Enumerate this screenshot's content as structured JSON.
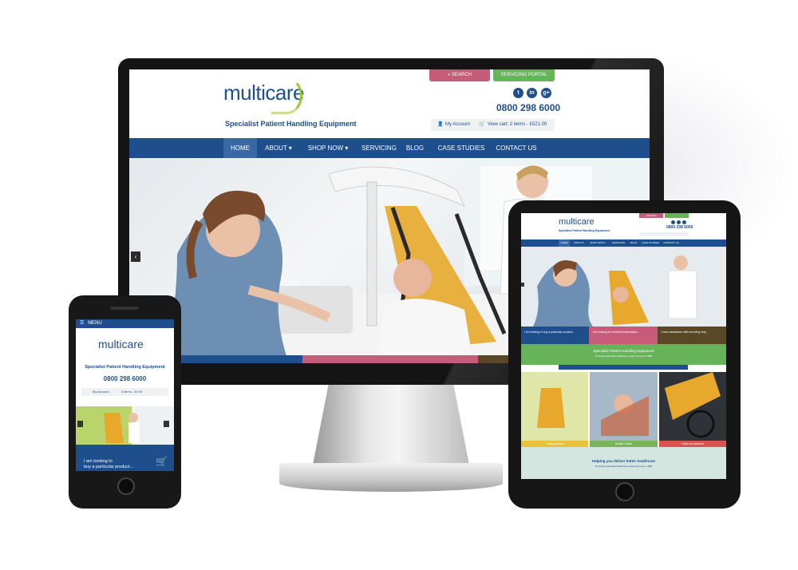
{
  "desktop": {
    "logo": "multicare",
    "tagline": "Specialist Patient Handling Equipment",
    "search_label": "SEARCH",
    "portal_label": "SERVICING PORTAL",
    "social": [
      "t",
      "in",
      "g+"
    ],
    "phone": "0800 298 6000",
    "my_account": "My Account",
    "cart": "View cart: 2 items - £521.00",
    "nav": [
      "HOME",
      "ABOUT ▾",
      "SHOP NOW ▾",
      "SERVICING",
      "BLOG",
      "CASE STUDIES",
      "CONTACT US"
    ],
    "hero_prev": "‹",
    "colors": {
      "brand_blue": "#1f4e8c",
      "pink": "#c75b7a",
      "green": "#66b35a",
      "lime": "#9cc83c"
    }
  },
  "tablet": {
    "logo": "multicare",
    "tagline": "Specialist Patient Handling Equipment",
    "phone": "0800 298 6000",
    "search_label": "SEARCH",
    "nav": [
      "HOME",
      "ABOUT ▾",
      "SHOP NOW ▾",
      "SERVICING",
      "BLOG",
      "CASE STUDIES",
      "CONTACT US"
    ],
    "tiles": [
      {
        "text": "I am looking to buy a particular product..."
      },
      {
        "text": "I am looking for technical information..."
      },
      {
        "text": "I need assistance with servicing help..."
      }
    ],
    "band_title": "Specialist Patient Handling Equipment",
    "band_sub": "Providing specialist healthcare equipment since 1988",
    "categories": [
      "Ceiling Hoists",
      "Mobile Hoists",
      "Hoist Accessories"
    ],
    "helping_title": "Helping you deliver better healthcare",
    "helping_sub": "Providing specialist healthcare equipment since 1988"
  },
  "phone_site": {
    "menu_label": "MENU",
    "logo": "multicare",
    "tagline": "Specialist Patient Handling Equipment",
    "phone": "0800 298 6000",
    "my_account": "My Account",
    "cart": "0 items - £0.00",
    "looking_line1": "I am looking to",
    "looking_line2": "buy a particular product..."
  }
}
